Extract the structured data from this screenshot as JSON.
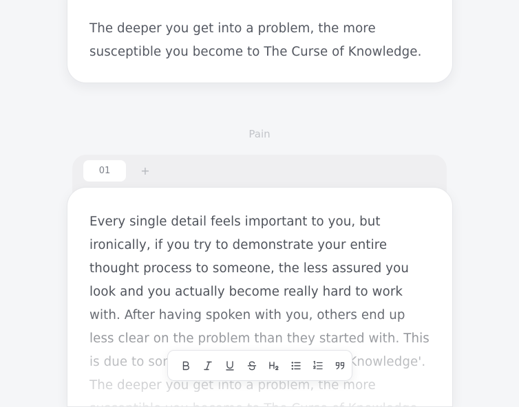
{
  "top_card": {
    "text": "The deeper you get into a problem, the more susceptible you become to The Curse of Knowledge."
  },
  "section": {
    "label": "Pain"
  },
  "tabs": {
    "items": [
      {
        "label": "01",
        "active": true
      }
    ],
    "add_label": "+"
  },
  "main_card": {
    "text": "Every single detail feels important to you, but ironically, if you try to demonstrate your entire thought process to someone, the less assured you look and you actually become really hard to work with. After having spoken with you, others end up less clear on the problem than they started with. This is due to something called 'The Curse of Knowledge'. The deeper you get into a problem, the more susceptible you become to The Curse of Knowledge."
  },
  "toolbar": {
    "tools": [
      {
        "name": "bold",
        "icon": "bold-icon"
      },
      {
        "name": "italic",
        "icon": "italic-icon"
      },
      {
        "name": "underline",
        "icon": "underline-icon"
      },
      {
        "name": "strikethrough",
        "icon": "strikethrough-icon"
      },
      {
        "name": "heading-2",
        "icon": "heading-2-icon"
      },
      {
        "name": "bullet-list",
        "icon": "bullet-list-icon"
      },
      {
        "name": "numbered-list",
        "icon": "numbered-list-icon"
      },
      {
        "name": "quote",
        "icon": "quote-icon"
      }
    ]
  },
  "colors": {
    "background": "#f5f6f8",
    "card": "#ffffff",
    "text": "#4f535b",
    "muted": "#c2c4c9",
    "tab_bar": "#efeff1"
  }
}
